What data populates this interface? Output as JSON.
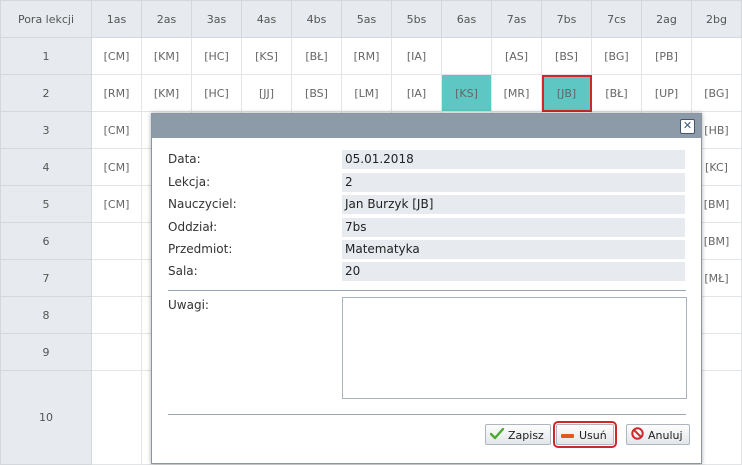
{
  "grid": {
    "corner_label": "Pora lekcji",
    "columns": [
      "1as",
      "2as",
      "3as",
      "4as",
      "4bs",
      "5as",
      "5bs",
      "6as",
      "7as",
      "7bs",
      "7cs",
      "2ag",
      "2bg"
    ],
    "rows": [
      {
        "num": "1",
        "cells": [
          "[CM]",
          "[KM]",
          "[HC]",
          "[KS]",
          "[BŁ]",
          "[RM]",
          "[IA]",
          "",
          "[AS]",
          "[BS]",
          "[BG]",
          "[PB]",
          ""
        ]
      },
      {
        "num": "2",
        "cells": [
          "[RM]",
          "[KM]",
          "[HC]",
          "[JJ]",
          "[BS]",
          "[LM]",
          "[IA]",
          "[KS]",
          "[MR]",
          "[JB]",
          "[BŁ]",
          "[UP]",
          "[BG]"
        ]
      },
      {
        "num": "3",
        "cells": [
          "[CM]",
          "",
          "",
          "",
          "",
          "",
          "",
          "",
          "",
          "",
          "",
          "",
          "[HB]"
        ]
      },
      {
        "num": "4",
        "cells": [
          "[CM]",
          "",
          "",
          "",
          "",
          "",
          "",
          "",
          "",
          "",
          "",
          "",
          "[KC]"
        ]
      },
      {
        "num": "5",
        "cells": [
          "[CM]",
          "",
          "",
          "",
          "",
          "",
          "",
          "",
          "",
          "",
          "",
          "",
          "[BM]"
        ]
      },
      {
        "num": "6",
        "cells": [
          "",
          "",
          "",
          "",
          "",
          "",
          "",
          "",
          "",
          "",
          "",
          "",
          "[BM]"
        ]
      },
      {
        "num": "7",
        "cells": [
          "",
          "",
          "",
          "",
          "",
          "",
          "",
          "",
          "",
          "",
          "",
          "",
          "[MŁ]"
        ]
      },
      {
        "num": "8",
        "cells": [
          "",
          "",
          "",
          "",
          "",
          "",
          "",
          "",
          "",
          "",
          "",
          "",
          ""
        ]
      },
      {
        "num": "9",
        "cells": [
          "",
          "",
          "",
          "",
          "",
          "",
          "",
          "",
          "",
          "",
          "",
          "",
          ""
        ]
      },
      {
        "num": "10",
        "cells": [
          "",
          "",
          "",
          "",
          "",
          "",
          "",
          "",
          "",
          "",
          "",
          "",
          ""
        ]
      }
    ],
    "highlight_color": "#5ec6c3"
  },
  "dialog": {
    "close_symbol": "✕",
    "fields": [
      {
        "label": "Data:",
        "value": "05.01.2018"
      },
      {
        "label": "Lekcja:",
        "value": "2"
      },
      {
        "label": "Nauczyciel:",
        "value": "Jan Burzyk [JB]"
      },
      {
        "label": "Oddział:",
        "value": "7bs"
      },
      {
        "label": "Przedmiot:",
        "value": "Matematyka"
      },
      {
        "label": "Sala:",
        "value": "20"
      }
    ],
    "notes_label": "Uwagi:",
    "notes_value": "",
    "buttons": {
      "save": "Zapisz",
      "delete": "Usuń",
      "cancel": "Anuluj"
    },
    "icons": {
      "save": "check-icon",
      "delete": "minus-icon",
      "cancel": "forbidden-icon"
    }
  }
}
